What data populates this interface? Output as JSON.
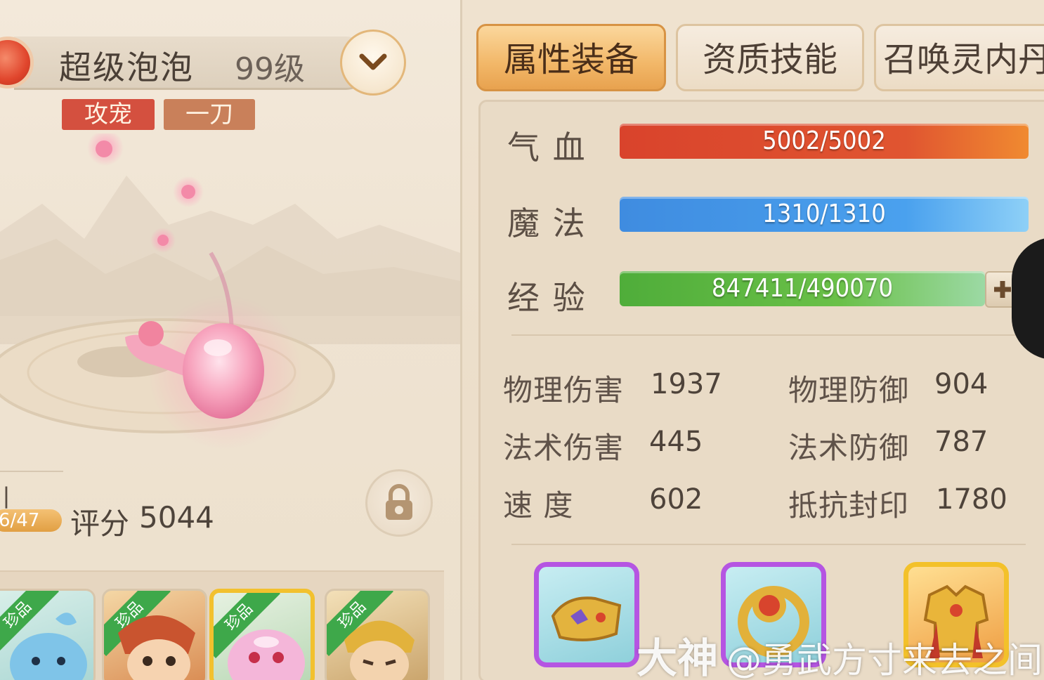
{
  "pet": {
    "name": "超级泡泡",
    "level": "99级",
    "tags": [
      "攻宠",
      "一刀"
    ],
    "growth_label_partial": "丨",
    "growth_progress": "6/47",
    "score_label": "评分",
    "score_value": "5044"
  },
  "tabs": [
    {
      "label": "属性装备",
      "active": true
    },
    {
      "label": "资质技能",
      "active": false
    },
    {
      "label": "召唤灵内丹",
      "active": false
    }
  ],
  "bars": {
    "hp": {
      "label": "气 血",
      "text": "5002/5002",
      "fill": 1.0
    },
    "mp": {
      "label": "魔 法",
      "text": "1310/1310",
      "fill": 1.0
    },
    "exp": {
      "label": "经 验",
      "text": "847411/490070",
      "fill": 1.0
    }
  },
  "attributes": {
    "left": [
      {
        "name": "物理伤害",
        "value": "1937"
      },
      {
        "name": "法术伤害",
        "value": "445"
      },
      {
        "name": "速 度",
        "value": "602"
      }
    ],
    "right": [
      {
        "name": "物理防御",
        "value": "904"
      },
      {
        "name": "法术防御",
        "value": "787"
      },
      {
        "name": "抵抗封印",
        "value": "1780"
      }
    ]
  },
  "pet_list": {
    "rare_label": "珍品",
    "cards": [
      {
        "icon": "blue-blob-pet-icon",
        "selected": false
      },
      {
        "icon": "warrior-pet-icon",
        "selected": false
      },
      {
        "icon": "pink-bubble-pet-icon",
        "selected": true
      },
      {
        "icon": "golden-helmet-pet-icon",
        "selected": false
      }
    ]
  },
  "equipment": [
    {
      "icon": "bracer-icon",
      "rarity_color": "#b555e2"
    },
    {
      "icon": "ring-icon",
      "rarity_color": "#b555e2"
    },
    {
      "icon": "armor-icon",
      "rarity_color": "#f3c12a"
    }
  ],
  "watermark": {
    "brand": "大神",
    "handle": "@勇武方寸来去之间"
  },
  "colors": {
    "hp": "#d9432c",
    "mp": "#3f8ce0",
    "exp": "#4fad3a",
    "active_tab": "#f2b768",
    "tag_attack": "#d4503f",
    "tag_oneblade": "#c9805a"
  }
}
